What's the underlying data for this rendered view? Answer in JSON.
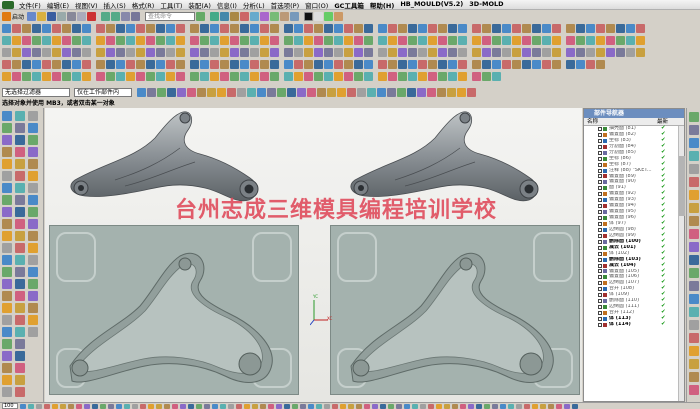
{
  "menu": [
    "文件(F)",
    "编辑(E)",
    "视图(V)",
    "插入(S)",
    "格式(R)",
    "工具(T)",
    "装配(A)",
    "信息(I)",
    "分析(L)",
    "首选项(P)",
    "窗口(O)",
    "GC工具箱",
    "帮助(H)",
    "HB_MOULD(V5.2)",
    "3D-MOLD"
  ],
  "toolbar": {
    "start_label": "启动",
    "search_placeholder": "查找命令",
    "filter_combo": "无选择过滤器",
    "scope_combo": "仅在工作部件内"
  },
  "status_prompt": "选择对象并使用 MB3，或者双击某一对象",
  "watermark": "台州志成三维模具编程培训学校",
  "triad": {
    "y": "YC",
    "x": "XC"
  },
  "navigator": {
    "title": "部件导航器",
    "col_name": "名称",
    "col_latest": "最新",
    "rows": [
      {
        "label": "抽壳面 (81)",
        "bold": false
      },
      {
        "label": "偏置面 (82)",
        "bold": false
      },
      {
        "label": "坐标 (83)",
        "bold": false
      },
      {
        "label": "分割面 (84)",
        "bold": false
      },
      {
        "label": "分割面 (85)",
        "bold": false
      },
      {
        "label": "坐标 (86)",
        "bold": false
      },
      {
        "label": "坐标 (87)",
        "bold": false
      },
      {
        "label": "注释 (88) \"SKET...",
        "bold": false
      },
      {
        "label": "偏置面 (89)",
        "bold": false
      },
      {
        "label": "偏置面 (90)",
        "bold": false
      },
      {
        "label": "面 (91)",
        "bold": false
      },
      {
        "label": "偏置面 (92)",
        "bold": false
      },
      {
        "label": "偏置面 (93)",
        "bold": false
      },
      {
        "label": "偏置面 (94)",
        "bold": false
      },
      {
        "label": "偏置面 (95)",
        "bold": false
      },
      {
        "label": "偏置面 (96)",
        "bold": false
      },
      {
        "label": "体 (97)",
        "bold": false
      },
      {
        "label": "边倒圆 (98)",
        "bold": false
      },
      {
        "label": "边倒圆 (99)",
        "bold": false
      },
      {
        "label": "删除面 (100)",
        "bold": true
      },
      {
        "label": "减去 (101)",
        "bold": true
      },
      {
        "label": "体 (102)",
        "bold": false
      },
      {
        "label": "删除面 (103)",
        "bold": true
      },
      {
        "label": "减去 (104)",
        "bold": true
      },
      {
        "label": "偏置面 (105)",
        "bold": false
      },
      {
        "label": "偏置面 (106)",
        "bold": false
      },
      {
        "label": "边倒圆 (107)",
        "bold": false
      },
      {
        "label": "合并 (108)",
        "bold": false
      },
      {
        "label": "体 (109)",
        "bold": false
      },
      {
        "label": "删除面 (110)",
        "bold": false
      },
      {
        "label": "边倒圆 (111)",
        "bold": false
      },
      {
        "label": "合并 (112)",
        "bold": false
      },
      {
        "label": "体 (113)",
        "bold": true
      },
      {
        "label": "体 (114)",
        "bold": true
      }
    ]
  },
  "zoom_value": "100"
}
